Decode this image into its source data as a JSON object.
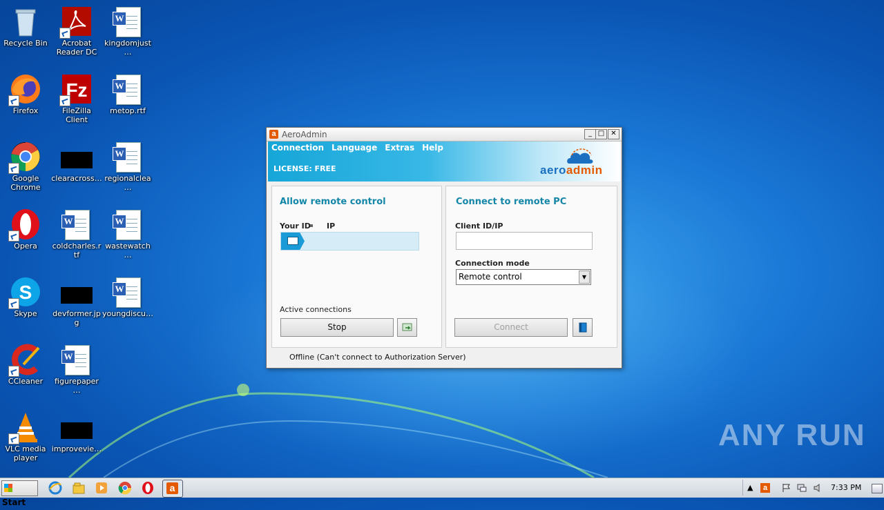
{
  "desktop": {
    "icons": [
      {
        "label": "Recycle Bin",
        "icon": "recycle-bin-icon"
      },
      {
        "label": "Acrobat Reader DC",
        "icon": "acrobat-icon"
      },
      {
        "label": "kingdomjust…",
        "icon": "word-doc-icon"
      },
      {
        "label": "Firefox",
        "icon": "firefox-icon"
      },
      {
        "label": "FileZilla Client",
        "icon": "filezilla-icon"
      },
      {
        "label": "metop.rtf",
        "icon": "word-doc-icon"
      },
      {
        "label": "Google Chrome",
        "icon": "chrome-icon"
      },
      {
        "label": "clearacross…",
        "icon": "black-thumbnail-icon"
      },
      {
        "label": "regionalclea…",
        "icon": "word-doc-icon"
      },
      {
        "label": "Opera",
        "icon": "opera-icon"
      },
      {
        "label": "coldcharles.rtf",
        "icon": "word-doc-icon"
      },
      {
        "label": "wastewatch…",
        "icon": "word-doc-icon"
      },
      {
        "label": "Skype",
        "icon": "skype-icon"
      },
      {
        "label": "devformer.jpg",
        "icon": "black-thumbnail-icon"
      },
      {
        "label": "youngdiscu…",
        "icon": "word-doc-icon"
      },
      {
        "label": "CCleaner",
        "icon": "ccleaner-icon"
      },
      {
        "label": "figurepaper…",
        "icon": "word-doc-icon"
      },
      {
        "label": "VLC media player",
        "icon": "vlc-icon"
      },
      {
        "label": "improvevie…",
        "icon": "black-thumbnail-icon"
      }
    ],
    "watermark": "ANY RUN"
  },
  "window": {
    "title": "AeroAdmin",
    "app_icon_letter": "a",
    "controls": {
      "minimize": "_",
      "maximize": "□",
      "close": "✕"
    },
    "menu": [
      "Connection",
      "Language",
      "Extras",
      "Help"
    ],
    "license": "LICENSE: FREE",
    "logo": {
      "aero": "aero",
      "admin": "admin"
    },
    "left_panel": {
      "title": "Allow remote control",
      "your_id_label": "Your ID",
      "ip_label": "IP",
      "active_connections_label": "Active connections",
      "stop_button": "Stop"
    },
    "right_panel": {
      "title": "Connect to remote PC",
      "client_id_label": "Client ID/IP",
      "client_id_value": "",
      "mode_label": "Connection mode",
      "mode_value": "Remote control",
      "connect_button": "Connect"
    },
    "status": "Offline (Can't connect to Authorization Server)"
  },
  "taskbar": {
    "start_label": "Start",
    "pinned": [
      "ie-icon",
      "explorer-icon",
      "media-player-icon",
      "chrome-icon",
      "opera-icon",
      "aeroadmin-icon"
    ],
    "clock": "7:33 PM"
  },
  "colors": {
    "accent": "#1487a8",
    "header_blue": "#16a6d8",
    "logo_orange": "#e45a00"
  }
}
